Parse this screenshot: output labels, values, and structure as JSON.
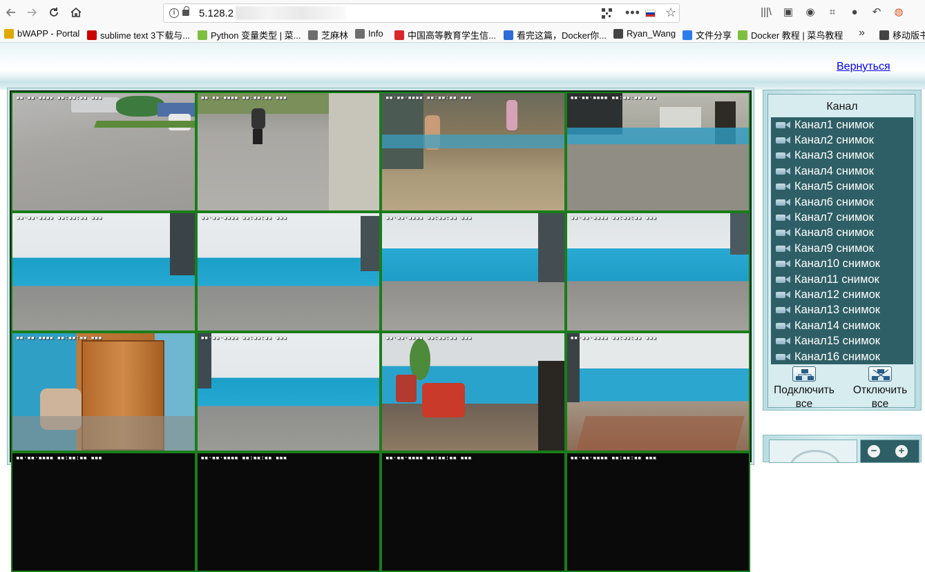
{
  "browser": {
    "url": "5.128.2",
    "flag": "ru",
    "bookmarks": [
      {
        "label": "bWAPP - Portal",
        "icon": "bee-icon",
        "color": "#e0a800"
      },
      {
        "label": "sublime text 3下载与...",
        "icon": "c-logo-icon",
        "color": "#cc0000"
      },
      {
        "label": "Python 变量类型 | 菜...",
        "icon": "runoob-icon",
        "color": "#7fbf3f"
      },
      {
        "label": "芝麻林",
        "icon": "globe-icon",
        "color": "#6d6d6d"
      },
      {
        "label": "Info",
        "icon": "globe-icon",
        "color": "#6d6d6d"
      },
      {
        "label": "中国高等教育学生信...",
        "icon": "chsi-icon",
        "color": "#d9262b"
      },
      {
        "label": "看完这篇，Docker你...",
        "icon": "paw-icon",
        "color": "#2f6bd6"
      },
      {
        "label": "Ryan_Wang",
        "icon": "home-icon",
        "color": "#444444"
      },
      {
        "label": "文件分享",
        "icon": "cloud-icon",
        "color": "#2b7de9"
      },
      {
        "label": "Docker 教程 | 菜鸟教程",
        "icon": "runoob-icon",
        "color": "#7fbf3f"
      },
      {
        "label": "移动版书签",
        "icon": "mobile-icon",
        "color": "#444444"
      }
    ]
  },
  "page": {
    "back_link": "Вернуться",
    "panel_title": "Канал",
    "channels": [
      "Канал1 снимок",
      "Канал2 снимок",
      "Канал3 снимок",
      "Канал4 снимок",
      "Канал5 снимок",
      "Канал6 снимок",
      "Канал7 снимок",
      "Канал8 снимок",
      "Канал9 снимок",
      "Канал10 снимок",
      "Канал11 снимок",
      "Канал12 снимок",
      "Канал13 снимок",
      "Канал14 снимок",
      "Канал15 снимок",
      "Канал16 снимок"
    ],
    "connect_all": "Подключить все",
    "disconnect_all": "Отключить все"
  }
}
